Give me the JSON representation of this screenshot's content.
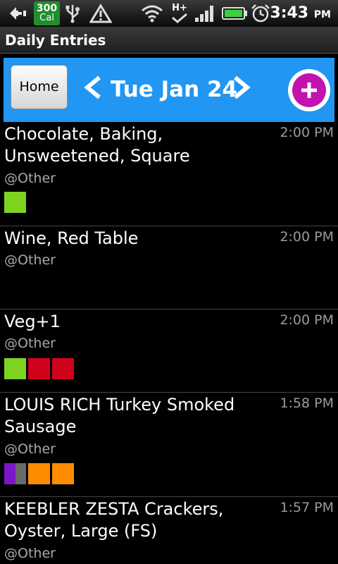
{
  "status_bar": {
    "icons": [
      "back-arrow-icon",
      "usb-icon",
      "warning-icon",
      "wifi-icon",
      "hplus-signal-icon",
      "cell-signal-icon",
      "battery-icon",
      "alarm-icon"
    ],
    "calorie_badge": {
      "number": "300",
      "unit": "Cal"
    },
    "time": "3:43",
    "ampm": "PM",
    "network_label": "H+"
  },
  "title_bar": {
    "title": "Daily Entries"
  },
  "nav": {
    "home_label": "Home",
    "date": "Tue Jan 24",
    "prev_icon": "chevron-left-icon",
    "next_icon": "chevron-right-icon",
    "add_icon": "plus-icon",
    "accent": "#2196f3",
    "add_color": "#c213b0"
  },
  "entries": [
    {
      "name_lines": [
        "Chocolate, Baking,",
        "Unsweetened, Square"
      ],
      "time": "2:00 PM",
      "category": "@Other",
      "swatches": [
        [
          "#7ed321"
        ]
      ]
    },
    {
      "name_lines": [
        "Wine, Red Table"
      ],
      "time": "2:00 PM",
      "category": "@Other",
      "swatches": []
    },
    {
      "name_lines": [
        "Veg+1"
      ],
      "time": "2:00 PM",
      "category": "@Other",
      "swatches": [
        [
          "#7ed321"
        ],
        [
          "#d0021b"
        ],
        [
          "#d0021b"
        ]
      ]
    },
    {
      "name_lines": [
        "LOUIS RICH Turkey Smoked",
        "Sausage"
      ],
      "time": "1:58 PM",
      "category": "@Other",
      "swatches": [
        [
          "#7b16c9",
          "#6a6a6a"
        ],
        [
          "#ff8c00"
        ],
        [
          "#ff8c00"
        ]
      ]
    },
    {
      "name_lines": [
        "KEEBLER ZESTA Crackers,",
        "Oyster, Large (FS)"
      ],
      "time": "1:57 PM",
      "category": "@Other",
      "swatches": []
    }
  ]
}
